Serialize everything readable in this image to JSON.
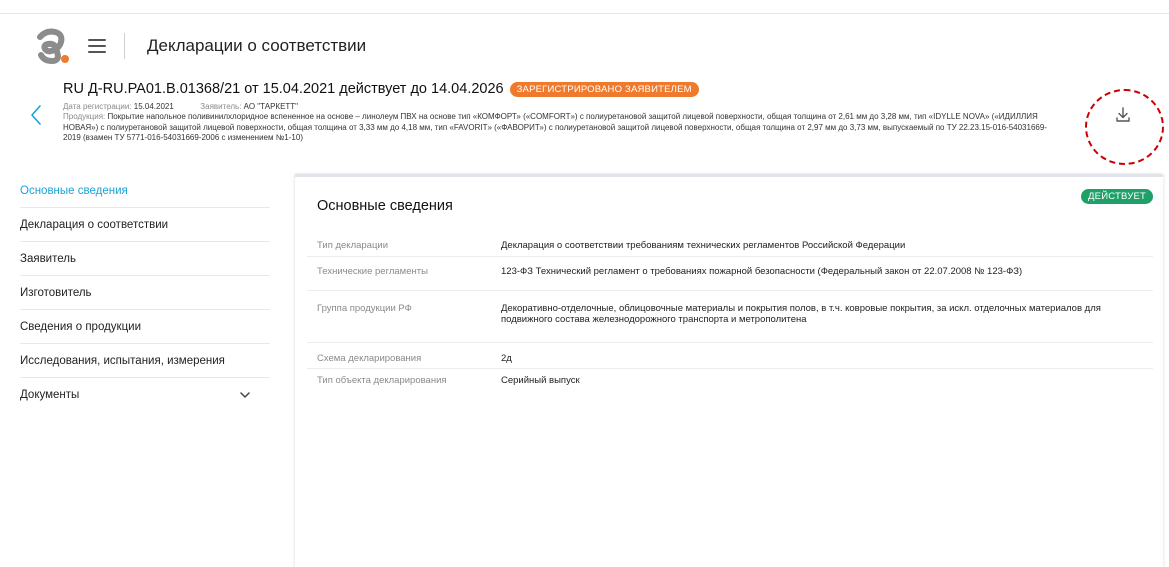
{
  "app": {
    "title": "Декларации о соответствии"
  },
  "declaration": {
    "title": "RU Д-RU.PA01.B.01368/21 от 15.04.2021 действует до 14.04.2026",
    "status": "ЗАРЕГИСТРИРОВАНО ЗАЯВИТЕЛЕМ",
    "reg_date_label": "Дата регистрации:",
    "reg_date": "15.04.2021",
    "applicant_label": "Заявитель:",
    "applicant": "АО \"ТАРКЕТТ\"",
    "product_label": "Продукция:",
    "product": "Покрытие напольное поливинилхлоридное вспененное на основе – линолеум ПВХ на основе тип «КОМФОРТ» («COMFORT») с полиуретановой защитой лицевой поверхности, общая толщина от 2,61 мм до 3,28 мм, тип «IDYLLE NOVA» («ИДИЛЛИЯ НОВАЯ») с полиуретановой защитой лицевой поверхности, общая толщина от 3,33 мм до 4,18 мм, тип «FAVORIT» («ФАВОРИТ») с полиуретановой защитой лицевой поверхности, общая толщина от 2,97 мм до 3,73 мм, выпускаемый по ТУ 22.23.15-016-54031669-2019 (взамен ТУ 5771-016-54031669-2006 с изменением №1-10)"
  },
  "sidebar": {
    "items": [
      {
        "label": "Основные сведения",
        "active": true
      },
      {
        "label": "Декларация о соответствии"
      },
      {
        "label": "Заявитель"
      },
      {
        "label": "Изготовитель"
      },
      {
        "label": "Сведения о продукции"
      },
      {
        "label": "Исследования, испытания, измерения"
      },
      {
        "label": "Документы",
        "expandable": true
      }
    ]
  },
  "main": {
    "title": "Основные сведения",
    "status": "ДЕЙСТВУЕТ",
    "fields": [
      {
        "label": "Тип декларации",
        "value": "Декларация о соответствии требованиям технических регламентов Российской Федерации"
      },
      {
        "label": "Технические регламенты",
        "value": "123-ФЗ Технический регламент о требованиях пожарной безопасности (Федеральный закон от 22.07.2008 № 123-ФЗ)"
      },
      {
        "label": "Группа продукции РФ",
        "value": "Декоративно-отделочные, облицовочные материалы и покрытия полов, в т.ч. ковровые покрытия, за искл. отделочных материалов для подвижного состава железнодорожного транспорта и метрополитена"
      },
      {
        "label": "Схема декларирования",
        "value": "2д"
      },
      {
        "label": "Тип объекта декларирования",
        "value": "Серийный выпуск"
      }
    ]
  },
  "colors": {
    "accent": "#1aa3d6",
    "status_registered": "#f07a2c",
    "status_active": "#1fa068",
    "logo_grey": "#8c8c8c",
    "logo_orange": "#f07a2c"
  },
  "icons": {
    "logo": "brand-logo",
    "menu": "hamburger-icon",
    "back": "chevron-left-icon",
    "download": "download-icon",
    "expand": "chevron-down-icon"
  }
}
